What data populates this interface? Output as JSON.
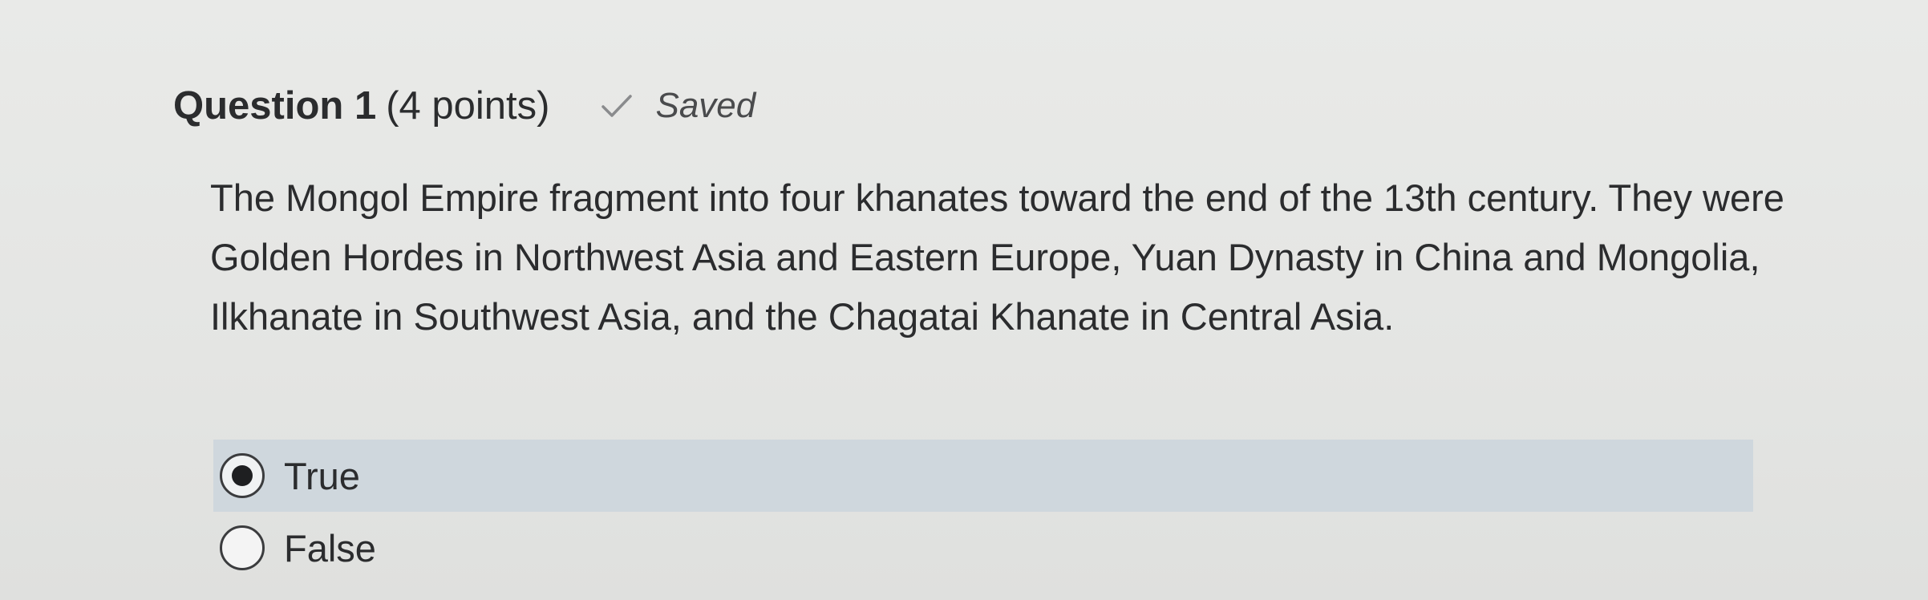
{
  "question": {
    "title": "Question 1",
    "points": "(4 points)",
    "status_icon": "checkmark-icon",
    "status": "Saved",
    "text": "The Mongol Empire fragment into four khanates toward the end of the 13th century. They were Golden Hordes in Northwest Asia and Eastern Europe, Yuan Dynasty in China and Mongolia, Ilkhanate in Southwest Asia, and the Chagatai Khanate in Central Asia."
  },
  "options": [
    {
      "label": "True",
      "selected": true
    },
    {
      "label": "False",
      "selected": false
    }
  ],
  "colors": {
    "selected_row_bg": "#cfd7dd",
    "text": "#2b2c2e"
  }
}
